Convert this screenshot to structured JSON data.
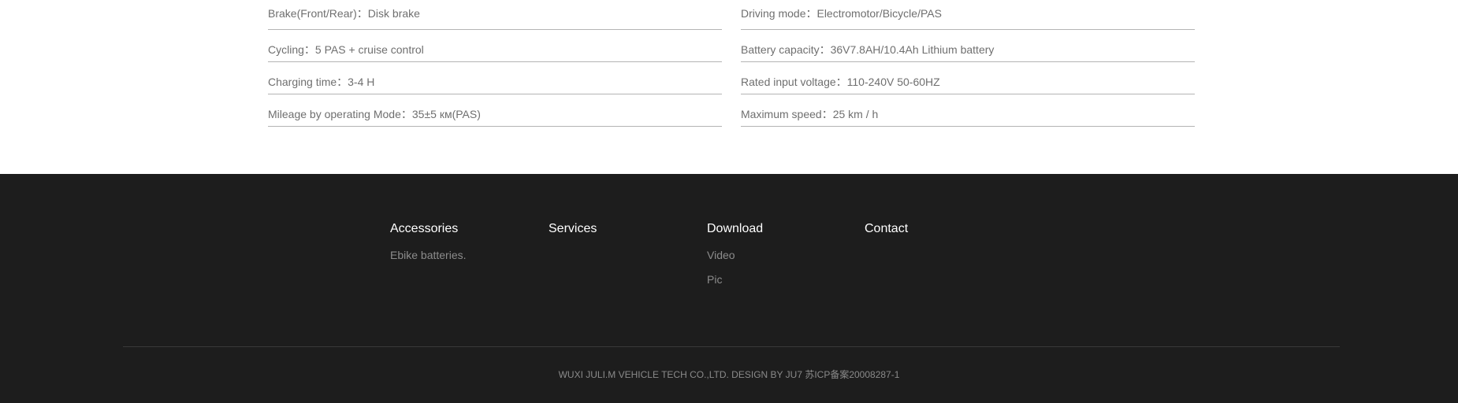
{
  "specs": {
    "left": [
      {
        "label": "Brake(Front/Rear)：Disk brake"
      },
      {
        "label": "Cycling：5 PAS + cruise control"
      },
      {
        "label": "Charging time：3-4 H"
      },
      {
        "label": "Mileage by operating Mode：35±5 км(PAS)"
      }
    ],
    "right": [
      {
        "label": "Driving mode：Electromotor/Bicycle/PAS"
      },
      {
        "label": "Battery capacity：36V7.8AH/10.4Ah  Lithium battery"
      },
      {
        "label": "Rated input voltage：110-240V 50-60HZ"
      },
      {
        "label": "Maximum speed：25 km / h"
      }
    ]
  },
  "footer": {
    "columns": [
      {
        "title": "Accessories",
        "links": [
          "Ebike batteries."
        ]
      },
      {
        "title": "Services",
        "links": []
      },
      {
        "title": "Download",
        "links": [
          "Video",
          "Pic"
        ]
      },
      {
        "title": "Contact",
        "links": []
      }
    ],
    "copyright": "WUXI JULI.M VEHICLE TECH CO.,LTD. DESIGN BY JU7 苏ICP备案20008287-1"
  }
}
